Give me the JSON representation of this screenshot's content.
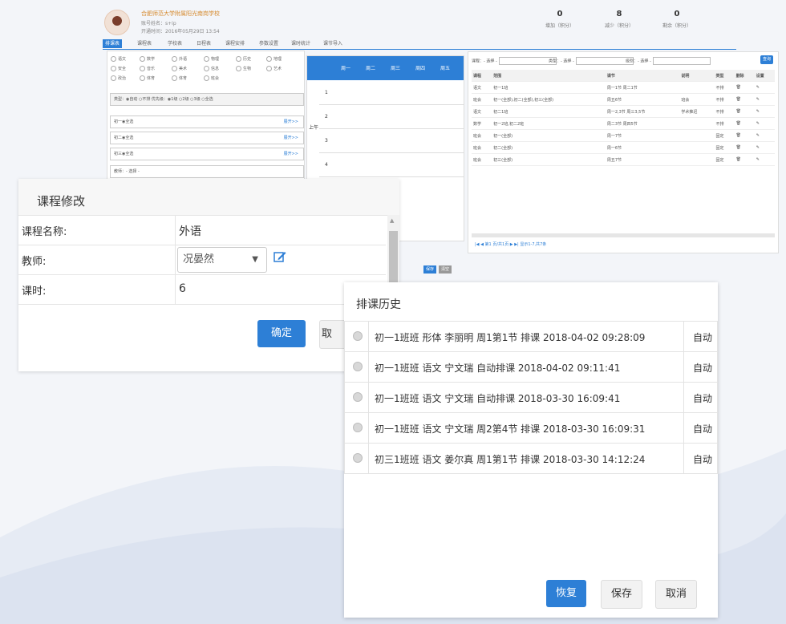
{
  "header": {
    "school_name": "合肥师范大学附属阳光南岗学校",
    "account": "账号姓名：s+ip",
    "valid_until": "开通时间：2016年05月29日 13:54",
    "stats": [
      {
        "value": "0",
        "label": "增加（积分）"
      },
      {
        "value": "8",
        "label": "减少（积分）"
      },
      {
        "value": "0",
        "label": "剩余（积分）"
      }
    ]
  },
  "nav": {
    "tabs": [
      "排课表",
      "课程表",
      "学校表",
      "日程表",
      "课程安排",
      "参数设置",
      "课时统计",
      "课节导入"
    ]
  },
  "left_panel": {
    "subjects": [
      "语文",
      "数学",
      "外语",
      "物理",
      "历史",
      "地理",
      "安全",
      "音乐",
      "美术",
      "信息",
      "生物",
      "艺术",
      "政治",
      "体育",
      "体育",
      "班会"
    ],
    "type_row": "类型：◉自动 ○不排  优先级：◉1级 ○2级 ○3级 ○全选",
    "grades": [
      "初一◉全选",
      "初二◉全选",
      "初三◉全选"
    ],
    "more": "展开>>",
    "teacher_filter": "教师：- 选择 -"
  },
  "grid": {
    "days": [
      "周一",
      "周二",
      "周三",
      "周四",
      "周五"
    ],
    "session": "上午",
    "periods": [
      "1",
      "2",
      "3",
      "4"
    ]
  },
  "right_panel": {
    "filters": [
      "课程：- 选择 -",
      "类型：- 选择 -",
      "级别：- 选择 -"
    ],
    "query": "查询",
    "columns": [
      "课程",
      "范围",
      "课节",
      "说明",
      "类型",
      "删除",
      "设置"
    ],
    "rows": [
      [
        "语文",
        "初一1班",
        "周一1节 周二1节",
        "",
        "不排",
        "",
        ""
      ],
      [
        "班会",
        "初一(全部),初二(全部),初三(全部)",
        "周五6节",
        "班会",
        "不排",
        "",
        ""
      ],
      [
        "语文",
        "初二1班",
        "周一2,3节 周三3,5节",
        "学术推迟",
        "不排",
        "",
        ""
      ],
      [
        "数学",
        "初一2班,初二2班",
        "周二3节 周四5节",
        "",
        "不排",
        "",
        ""
      ],
      [
        "班会",
        "初一(全部)",
        "周一7节",
        "",
        "固定",
        "",
        ""
      ],
      [
        "班会",
        "初二(全部)",
        "周一6节",
        "",
        "固定",
        "",
        ""
      ],
      [
        "班会",
        "初三(全部)",
        "周五7节",
        "",
        "固定",
        "",
        ""
      ]
    ],
    "pager": "|◀ ◀ 第1 页/共1页 ▶ ▶| 显示1-7,共7条"
  },
  "small_buttons": [
    "保存",
    "清空"
  ],
  "course_dialog": {
    "title": "课程修改",
    "fields": [
      {
        "label": "课程名称:",
        "value": "外语"
      },
      {
        "label": "教师:",
        "value": "况晏然"
      },
      {
        "label": "课时:",
        "value": "6"
      }
    ],
    "confirm": "确定",
    "cancel": "取"
  },
  "history_dialog": {
    "title": "排课历史",
    "records": [
      {
        "text": "初一1班班 形体 李丽明 周1第1节 排课 2018-04-02 09:28:09",
        "type": "自动"
      },
      {
        "text": "初一1班班 语文 宁文瑞 自动排课 2018-04-02 09:11:41",
        "type": "自动"
      },
      {
        "text": "初一1班班 语文 宁文瑞 自动排课 2018-03-30 16:09:41",
        "type": "自动"
      },
      {
        "text": "初一1班班 语文 宁文瑞 周2第4节 排课 2018-03-30 16:09:31",
        "type": "自动"
      },
      {
        "text": "初三1班班 语文 姜尔真 周1第1节 排课 2018-03-30 14:12:24",
        "type": "自动"
      }
    ],
    "restore": "恢复",
    "save": "保存",
    "cancel": "取消"
  },
  "colors": {
    "accent": "#2d7fd6",
    "background": "#f3f5f9"
  }
}
